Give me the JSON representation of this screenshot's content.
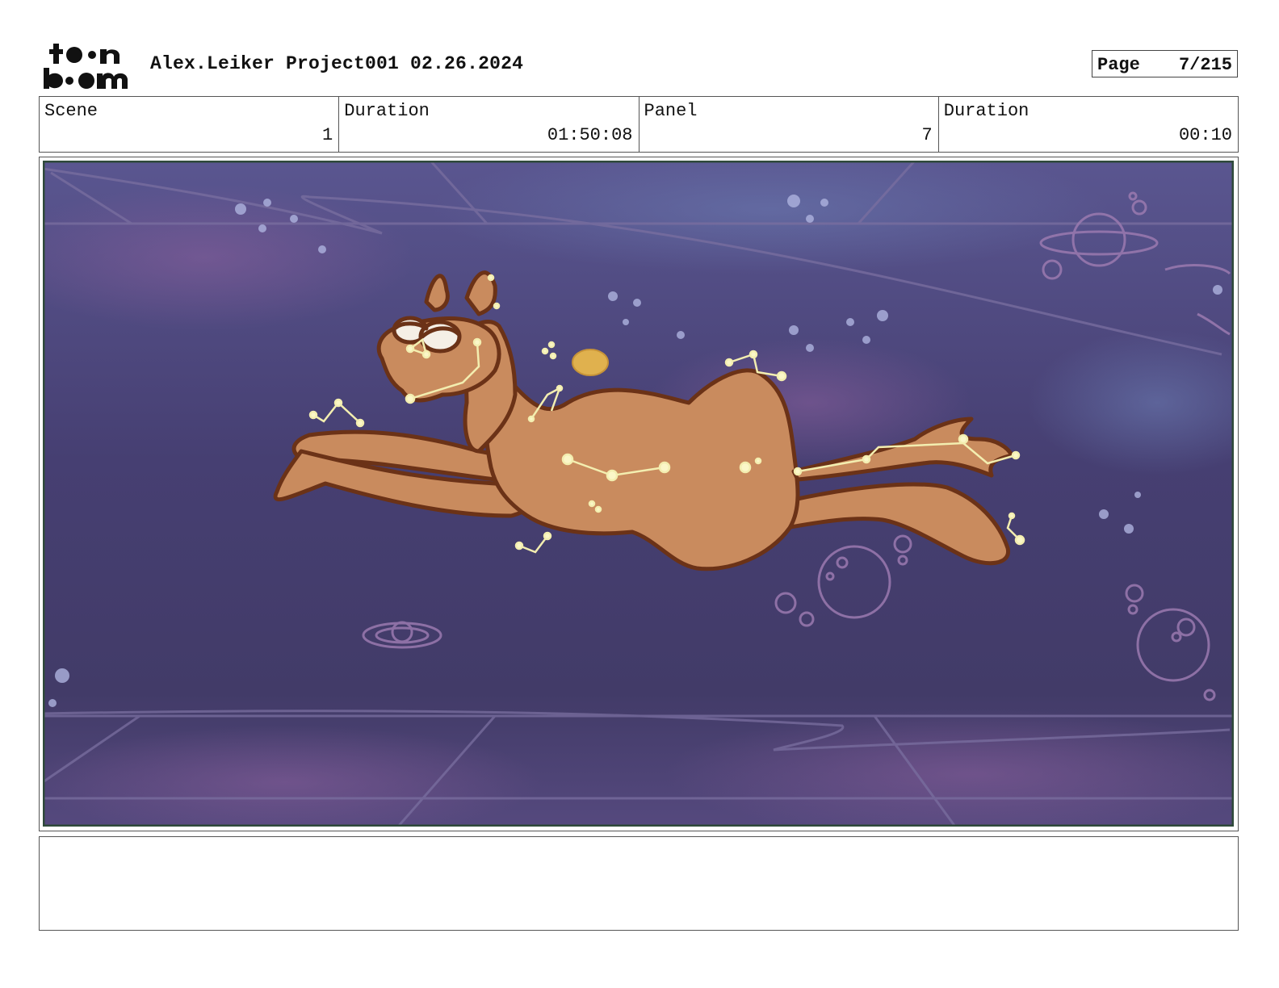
{
  "header": {
    "logo_text": "toon boom",
    "project_title": "Alex.Leiker Project001 02.26.2024",
    "page_label": "Page",
    "page_value": "7/215"
  },
  "info_row": [
    {
      "label": "Scene",
      "value": "1"
    },
    {
      "label": "Duration",
      "value": "01:50:08"
    },
    {
      "label": "Panel",
      "value": "7"
    },
    {
      "label": "Duration",
      "value": "00:10"
    }
  ],
  "panel": {
    "subject": "camel",
    "icon": "storyboard-drawing"
  },
  "notes": {
    "text": ""
  }
}
